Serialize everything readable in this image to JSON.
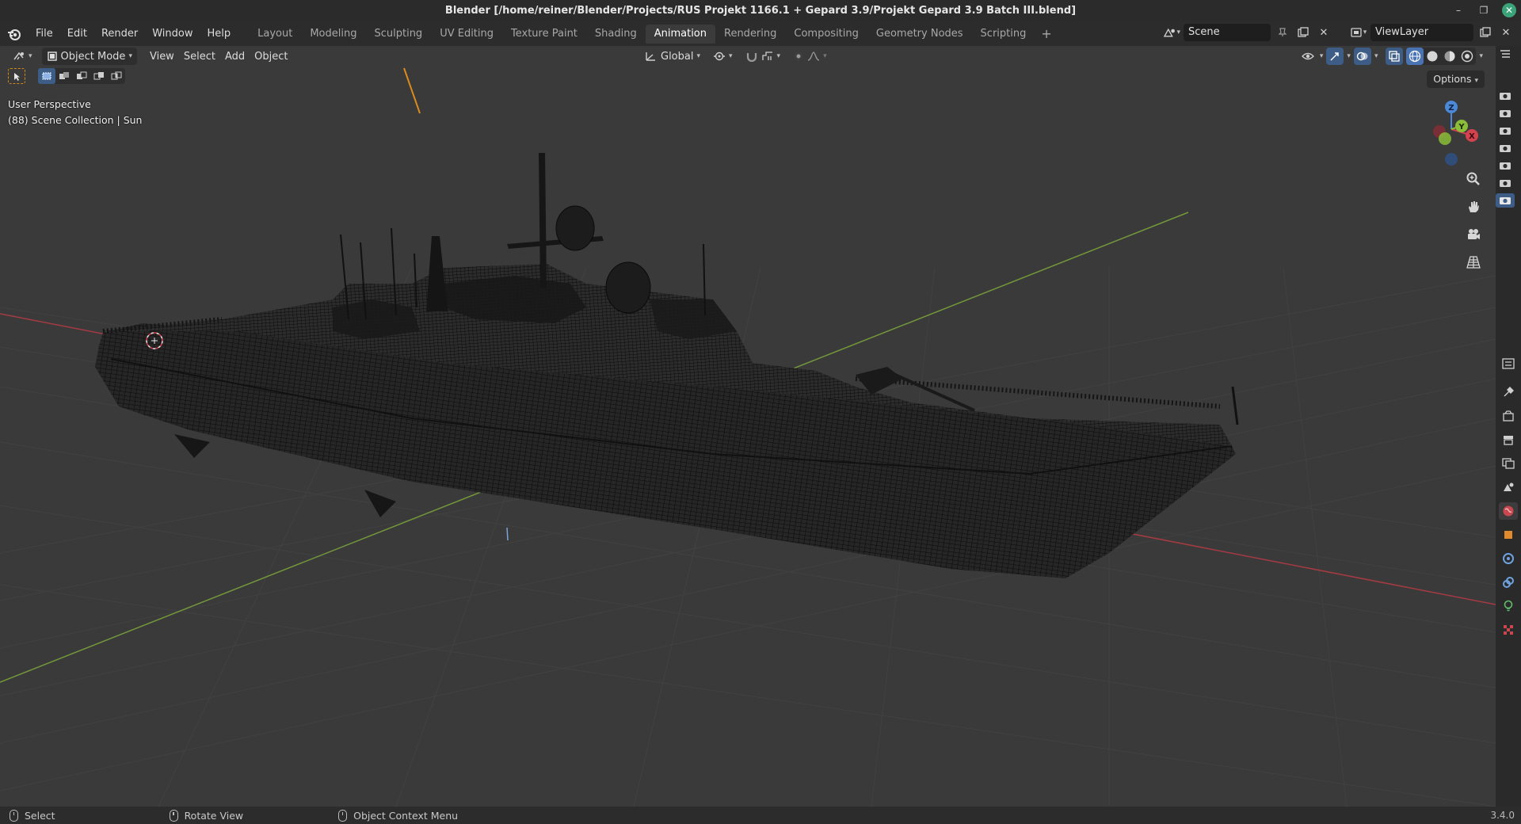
{
  "window": {
    "title": "Blender [/home/reiner/Blender/Projects/RUS Projekt 1166.1 + Gepard 3.9/Projekt Gepard 3.9 Batch III.blend]",
    "controls": [
      "minimize-icon",
      "maximize-icon",
      "close-icon"
    ]
  },
  "menu": {
    "items": [
      "File",
      "Edit",
      "Render",
      "Window",
      "Help"
    ]
  },
  "workspaces": {
    "tabs": [
      "Layout",
      "Modeling",
      "Sculpting",
      "UV Editing",
      "Texture Paint",
      "Shading",
      "Animation",
      "Rendering",
      "Compositing",
      "Geometry Nodes",
      "Scripting"
    ],
    "active": "Animation",
    "add_label": "+"
  },
  "scene": {
    "name": "Scene"
  },
  "view_layer": {
    "name": "ViewLayer"
  },
  "viewport_header": {
    "mode": "Object Mode",
    "menus": [
      "View",
      "Select",
      "Add",
      "Object"
    ],
    "orientation": "Global",
    "options_label": "Options"
  },
  "viewport": {
    "perspective_label": "User Perspective",
    "collection_label": "(88) Scene Collection | Sun",
    "gizmo_axes": [
      "Z",
      "Y",
      "X"
    ],
    "colors": {
      "x_axis": "#d3424f",
      "y_axis": "#8bbd3a",
      "z_axis": "#4b89d8",
      "grid": "#474747",
      "background": "#3a3a3a",
      "mesh": "#0d0d0d"
    }
  },
  "statusbar": {
    "items": [
      "Select",
      "Rotate View",
      "Object Context Menu"
    ],
    "version": "3.4.0"
  }
}
